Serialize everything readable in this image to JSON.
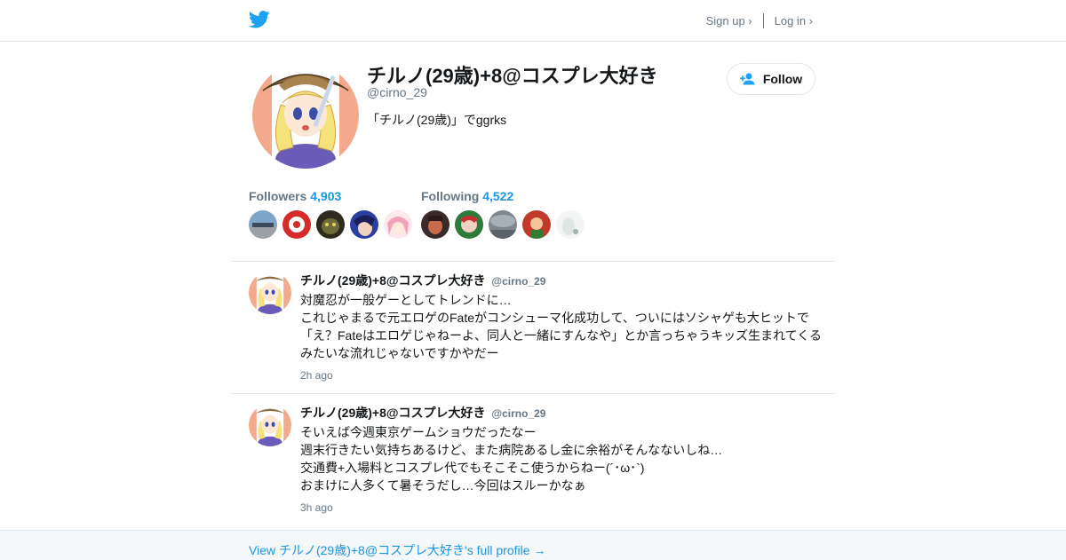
{
  "header": {
    "logo_icon": "twitter-bird-icon",
    "signup": "Sign up ›",
    "login": "Log in ›",
    "brand_color": "#1da1f2"
  },
  "profile": {
    "name": "チルノ(29歳)+8@コスプレ大好き",
    "handle": "@cirno_29",
    "bio": "「チルノ(29歳)」でggrks",
    "follow_label": "Follow",
    "follow_icon": "add-user-icon"
  },
  "stats": {
    "followers_label": "Followers",
    "followers_count": "4,903",
    "following_label": "Following",
    "following_count": "4,522"
  },
  "tweets": [
    {
      "name": "チルノ(29歳)+8@コスプレ大好き",
      "handle": "@cirno_29",
      "lines": [
        "対魔忍が一般ゲーとしてトレンドに…",
        "これじゃまるで元エロゲのFateがコンシューマ化成功して、ついにはソシャゲも大ヒットで",
        "「え？Fateはエロゲじゃねーよ、同人と一緒にすんなや」とか言っちゃうキッズ生まれてくる",
        "みたいな流れじゃないですかやだー"
      ],
      "time": "2h ago"
    },
    {
      "name": "チルノ(29歳)+8@コスプレ大好き",
      "handle": "@cirno_29",
      "lines": [
        "そいえば今週東京ゲームショウだったなー",
        "週末行きたい気持ちあるけど、また病院あるし金に余裕がそんなないしね…",
        "交通費+入場料とコスプレ代でもそこそこ使うからねー(´･ω･`)",
        "おまけに人多くて暑そうだし…今回はスルーかなぁ"
      ],
      "time": "3h ago"
    }
  ],
  "footer": {
    "link": "View チルノ(29歳)+8@コスプレ大好き's full profile →",
    "link_color": "#1b95e0"
  }
}
